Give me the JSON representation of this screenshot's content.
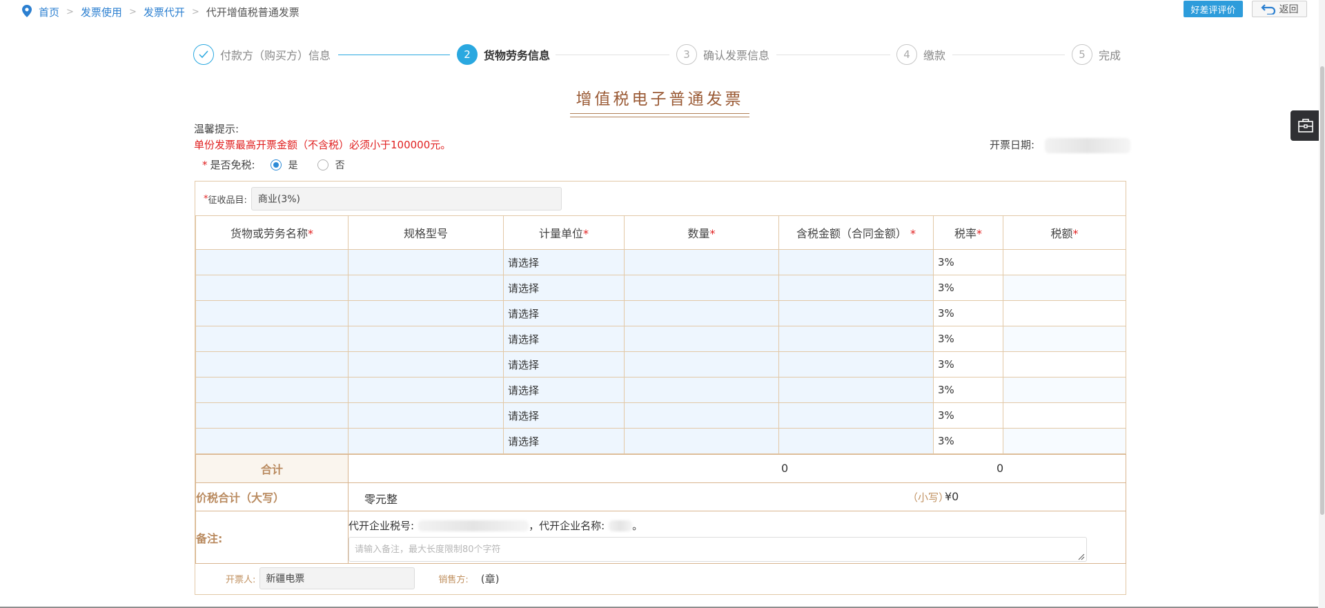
{
  "breadcrumb": {
    "items": [
      "首页",
      "发票使用",
      "发票代开"
    ],
    "separator": ">",
    "current": "代开增值税普通发票"
  },
  "header_buttons": {
    "rate": "好差评评价",
    "back": "返回"
  },
  "steps": [
    {
      "number": "1",
      "label": "付款方（购买方）信息",
      "state": "done"
    },
    {
      "number": "2",
      "label": "货物劳务信息",
      "state": "active"
    },
    {
      "number": "3",
      "label": "确认发票信息",
      "state": "pending"
    },
    {
      "number": "4",
      "label": "缴款",
      "state": "pending"
    },
    {
      "number": "5",
      "label": "完成",
      "state": "pending"
    }
  ],
  "invoice_title": "增值税电子普通发票",
  "tip": {
    "label": "温馨提示:",
    "warning": "单份发票最高开票金额（不含税）必须小于100000元。"
  },
  "date_label": "开票日期:",
  "exempt": {
    "required_mark": "*",
    "label": "是否免税:",
    "options": [
      "是",
      "否"
    ],
    "selected": "是"
  },
  "category": {
    "required_mark": "*",
    "label": "征收品目:",
    "value": "商业(3%)"
  },
  "table": {
    "headers": [
      {
        "text": "货物或劳务名称",
        "required": "*"
      },
      {
        "text": "规格型号",
        "required": ""
      },
      {
        "text": "计量单位",
        "required": "*"
      },
      {
        "text": "数量",
        "required": "*"
      },
      {
        "text": "含税金额（合同金额）",
        "required": " *"
      },
      {
        "text": "税率",
        "required": "*"
      },
      {
        "text": "税额",
        "required": "*"
      }
    ],
    "rows": [
      {
        "unit_placeholder": "请选择",
        "rate": "3%"
      },
      {
        "unit_placeholder": "请选择",
        "rate": "3%"
      },
      {
        "unit_placeholder": "请选择",
        "rate": "3%"
      },
      {
        "unit_placeholder": "请选择",
        "rate": "3%"
      },
      {
        "unit_placeholder": "请选择",
        "rate": "3%"
      },
      {
        "unit_placeholder": "请选择",
        "rate": "3%"
      },
      {
        "unit_placeholder": "请选择",
        "rate": "3%"
      },
      {
        "unit_placeholder": "请选择",
        "rate": "3%"
      }
    ]
  },
  "summary": {
    "total_label": "合计",
    "total_amount": "0",
    "total_tax": "0",
    "caps_label": "价税合计（大写）",
    "caps_value": "零元整",
    "small_label": "（小写）",
    "small_value": "¥0"
  },
  "remark": {
    "label": "备注:",
    "tax_id_label": "代开企业税号:",
    "name_label": "，代开企业名称:",
    "end": "。",
    "placeholder": "请输入备注，最大长度限制80个字符"
  },
  "footer": {
    "issuer_label": "开票人:",
    "issuer_value": "新疆电票",
    "seller_label": "销售方:",
    "seller_value": "(章)"
  },
  "colors": {
    "accent": "#2aa8e0",
    "warning": "#e02020",
    "gold": "#b98a5f",
    "border": "#e2c8a6"
  },
  "icons": [
    "location-pin-icon",
    "back-arrow-icon",
    "check-icon",
    "toolbox-icon",
    "resize-handle-icon"
  ]
}
